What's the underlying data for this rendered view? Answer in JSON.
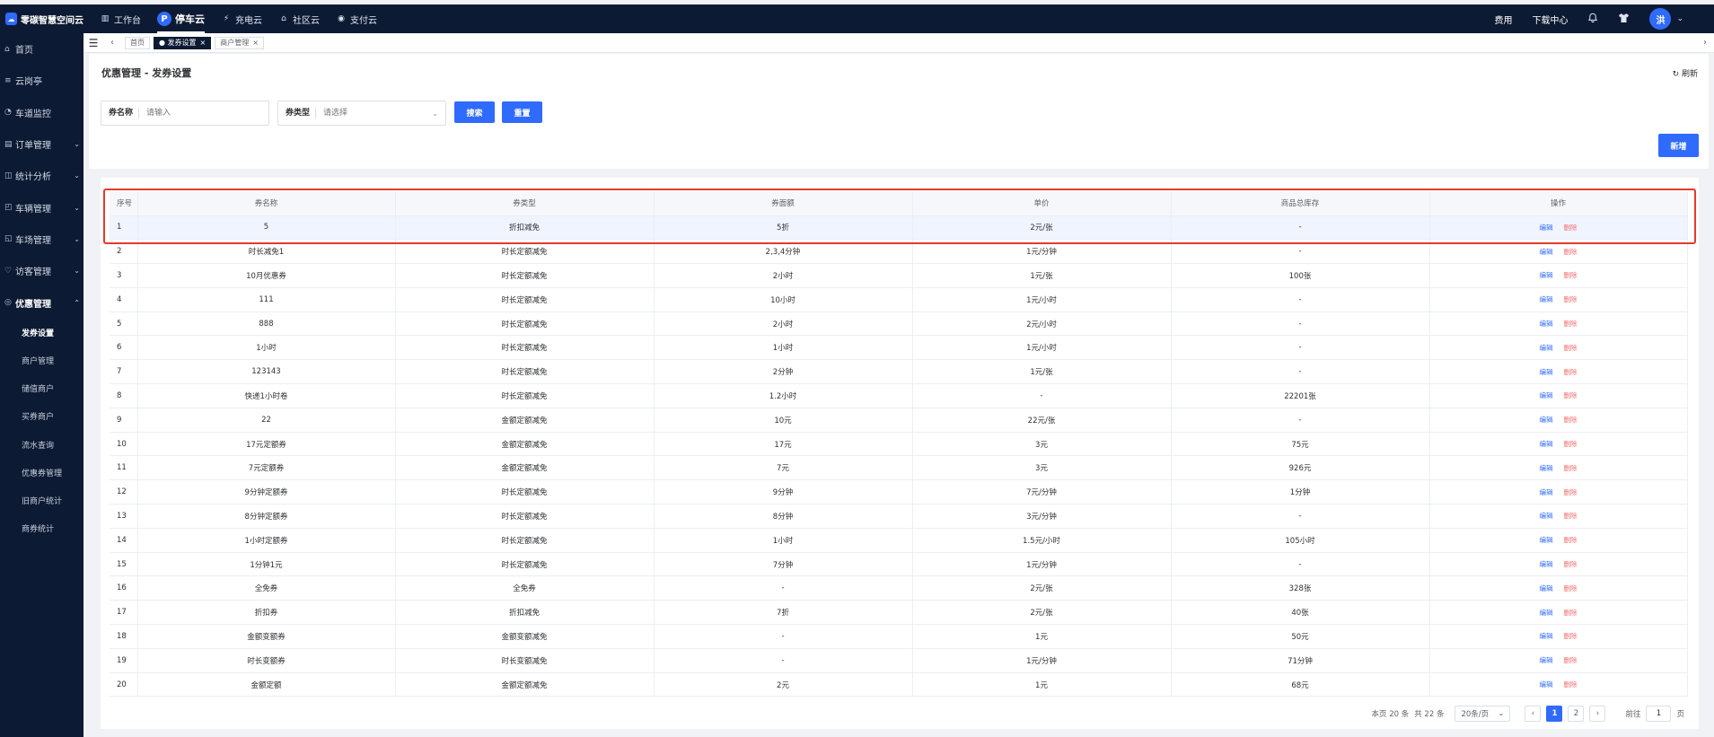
{
  "brand": {
    "name": "零碳智慧空间云",
    "logo_icon": "cloud-logo-icon"
  },
  "topnav": [
    {
      "label": "工作台",
      "icon": "▥",
      "active": false
    },
    {
      "label": "停车云",
      "icon": "P",
      "active": true
    },
    {
      "label": "充电云",
      "icon": "⚡",
      "active": false
    },
    {
      "label": "社区云",
      "icon": "⌂",
      "active": false
    },
    {
      "label": "支付云",
      "icon": "◉",
      "active": false
    }
  ],
  "topright": {
    "fee": "费用",
    "download": "下载中心",
    "avatar": "洪"
  },
  "sidebar": {
    "items": [
      {
        "label": "首页",
        "icon": "⌂",
        "arrow": false
      },
      {
        "label": "云岗亭",
        "icon": "≡",
        "arrow": false
      },
      {
        "label": "车道监控",
        "icon": "◔",
        "arrow": false
      },
      {
        "label": "订单管理",
        "icon": "▤",
        "arrow": true
      },
      {
        "label": "统计分析",
        "icon": "◫",
        "arrow": true
      },
      {
        "label": "车辆管理",
        "icon": "◰",
        "arrow": true
      },
      {
        "label": "车场管理",
        "icon": "◱",
        "arrow": true
      },
      {
        "label": "访客管理",
        "icon": "♡",
        "arrow": true
      },
      {
        "label": "优惠管理",
        "icon": "◎",
        "arrow": true
      }
    ],
    "subitems": [
      "发券设置",
      "商户管理",
      "储值商户",
      "买券商户",
      "流水查询",
      "优惠券管理",
      "旧商户统计",
      "商券统计"
    ]
  },
  "tabs": [
    {
      "label": "首页",
      "active": false,
      "closable": false
    },
    {
      "label": "● 发券设置",
      "active": true,
      "closable": true
    },
    {
      "label": "商户管理",
      "active": false,
      "closable": true
    }
  ],
  "page": {
    "title": "优惠管理 - 发券设置",
    "refresh": "刷新",
    "filters": {
      "name_label": "券名称",
      "name_placeholder": "请输入",
      "type_label": "券类型",
      "type_placeholder": "请选择"
    },
    "search_btn": "搜索",
    "reset_btn": "重置",
    "add_btn": "新增"
  },
  "table": {
    "columns": [
      "序号",
      "券名称",
      "券类型",
      "券面额",
      "单价",
      "商品总库存",
      "操作"
    ],
    "edit_label": "编辑",
    "delete_label": "删除",
    "rows": [
      [
        "1",
        "5",
        "折扣减免",
        "5折",
        "2元/张",
        "-"
      ],
      [
        "2",
        "时长减免1",
        "时长定额减免",
        "2,3,4分钟",
        "1元/分钟",
        "-"
      ],
      [
        "3",
        "10月优惠券",
        "时长定额减免",
        "2小时",
        "1元/张",
        "100张"
      ],
      [
        "4",
        "111",
        "时长定额减免",
        "10小时",
        "1元/小时",
        "-"
      ],
      [
        "5",
        "888",
        "时长定额减免",
        "2小时",
        "2元/小时",
        "-"
      ],
      [
        "6",
        "1小时",
        "时长定额减免",
        "1小时",
        "1元/小时",
        "-"
      ],
      [
        "7",
        "123143",
        "时长定额减免",
        "2分钟",
        "1元/张",
        "-"
      ],
      [
        "8",
        "快递1小时卷",
        "时长定额减免",
        "1.2小时",
        "-",
        "22201张"
      ],
      [
        "9",
        "22",
        "金额定额减免",
        "10元",
        "22元/张",
        "-"
      ],
      [
        "10",
        "17元定额券",
        "金额定额减免",
        "17元",
        "3元",
        "75元"
      ],
      [
        "11",
        "7元定额券",
        "金额定额减免",
        "7元",
        "3元",
        "926元"
      ],
      [
        "12",
        "9分钟定额券",
        "时长定额减免",
        "9分钟",
        "7元/分钟",
        "1分钟"
      ],
      [
        "13",
        "8分钟定额券",
        "时长定额减免",
        "8分钟",
        "3元/分钟",
        "-"
      ],
      [
        "14",
        "1小时定额券",
        "时长定额减免",
        "1小时",
        "1.5元/小时",
        "105小时"
      ],
      [
        "15",
        "1分钟1元",
        "时长定额减免",
        "7分钟",
        "1元/分钟",
        "-"
      ],
      [
        "16",
        "全免券",
        "全免券",
        "-",
        "2元/张",
        "328张"
      ],
      [
        "17",
        "折扣券",
        "折扣减免",
        "7折",
        "2元/张",
        "40张"
      ],
      [
        "18",
        "金额变额券",
        "金额变额减免",
        "-",
        "1元",
        "50元"
      ],
      [
        "19",
        "时长变额券",
        "时长变额减免",
        "-",
        "1元/分钟",
        "71分钟"
      ],
      [
        "20",
        "金额定额",
        "金额定额减免",
        "2元",
        "1元",
        "68元"
      ]
    ]
  },
  "pagination": {
    "page_info": "本页 20 条",
    "total": "共 22 条",
    "size": "20条/页",
    "pages": [
      "1",
      "2"
    ],
    "current": "1",
    "goto_label": "前往",
    "goto_value": "1",
    "page_suffix": "页"
  }
}
